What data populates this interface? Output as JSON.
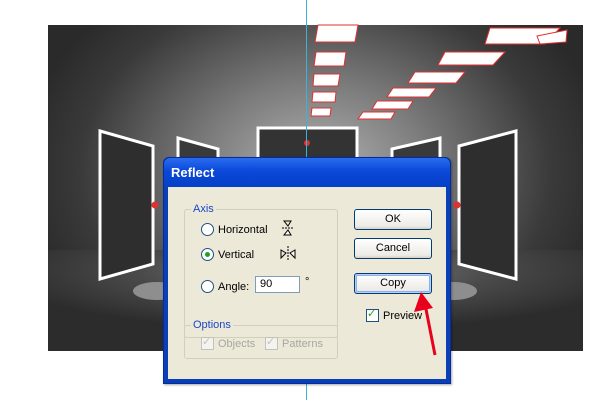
{
  "dialog": {
    "title": "Reflect",
    "axis_group": {
      "legend": "Axis",
      "horizontal_label": "Horizontal",
      "vertical_label": "Vertical",
      "angle_label": "Angle:",
      "angle_value": "90",
      "degree_symbol": "°",
      "selected": "vertical"
    },
    "options_group": {
      "legend": "Options",
      "objects_label": "Objects",
      "patterns_label": "Patterns"
    },
    "buttons": {
      "ok": "OK",
      "cancel": "Cancel",
      "copy": "Copy"
    },
    "preview_label": "Preview"
  },
  "colors": {
    "title_bar": "#0a48d8",
    "dialog_face": "#ece9d8",
    "guide_line": "#38b4d8",
    "selection": "#e03030",
    "annotation_arrow": "#e8001c"
  },
  "icons": [
    "reflect-horizontal-icon",
    "reflect-vertical-icon",
    "red-annotation-arrow-icon"
  ]
}
